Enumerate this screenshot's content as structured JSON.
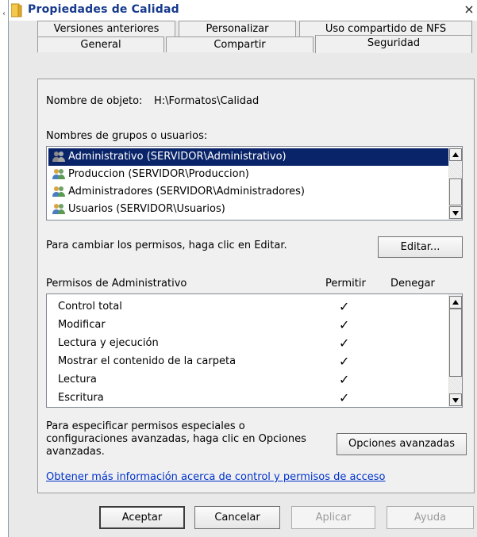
{
  "window": {
    "title": "Propiedades de Calidad",
    "close_glyph": "×"
  },
  "tabs": {
    "row1": [
      "Versiones anteriores",
      "Personalizar",
      "Uso compartido de NFS"
    ],
    "row2": [
      "General",
      "Compartir",
      "Seguridad"
    ],
    "active": "Seguridad"
  },
  "security": {
    "object_label": "Nombre de objeto:",
    "object_value": "H:\\Formatos\\Calidad",
    "groups_label": "Nombres de grupos o usuarios:",
    "groups": [
      "Administrativo (SERVIDOR\\Administrativo)",
      "Produccion (SERVIDOR\\Produccion)",
      "Administradores (SERVIDOR\\Administradores)",
      "Usuarios (SERVIDOR\\Usuarios)"
    ],
    "selected_group_index": 0,
    "change_text": "Para cambiar los permisos, haga clic en Editar.",
    "edit_label": "Editar...",
    "perms_label": "Permisos de Administrativo",
    "allow_header": "Permitir",
    "deny_header": "Denegar",
    "permissions": [
      {
        "name": "Control total",
        "allow": "✓",
        "deny": ""
      },
      {
        "name": "Modificar",
        "allow": "✓",
        "deny": ""
      },
      {
        "name": "Lectura y ejecución",
        "allow": "✓",
        "deny": ""
      },
      {
        "name": "Mostrar el contenido de la carpeta",
        "allow": "✓",
        "deny": ""
      },
      {
        "name": "Lectura",
        "allow": "✓",
        "deny": ""
      },
      {
        "name": "Escritura",
        "allow": "✓",
        "deny": ""
      }
    ],
    "special_line1": "Para especificar permisos especiales o",
    "special_line2": "configuraciones avanzadas, haga clic en Opciones",
    "special_line3": "avanzadas.",
    "advanced_label": "Opciones avanzadas",
    "link_text": "Obtener más información acerca de control y permisos de acceso"
  },
  "footer": {
    "ok": "Aceptar",
    "cancel": "Cancelar",
    "apply": "Aplicar",
    "help": "Ayuda"
  },
  "colors": {
    "selection": "#0a246a",
    "title_text": "#163a8c",
    "link": "#0033cc"
  }
}
